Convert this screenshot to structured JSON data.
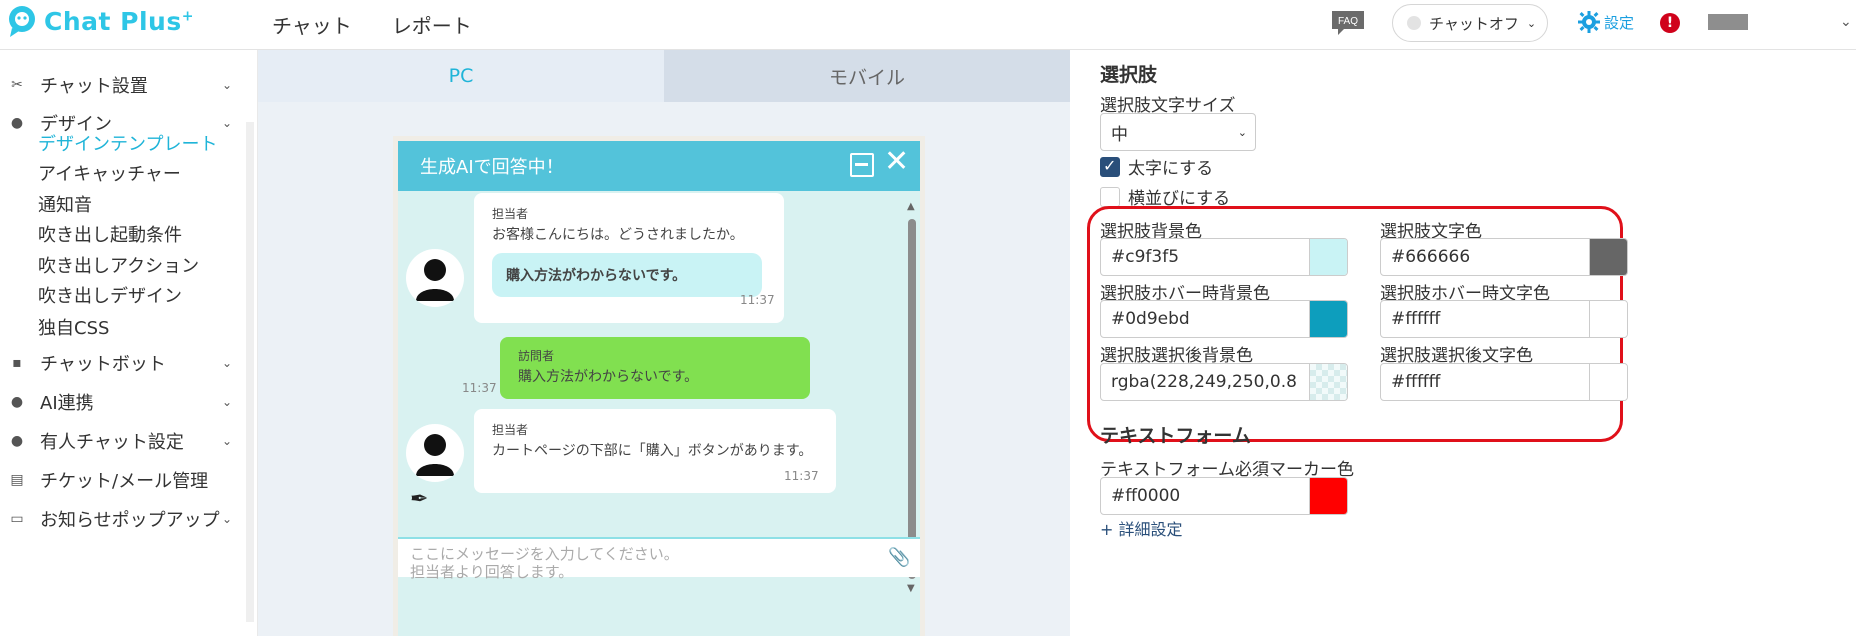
{
  "app": {
    "logo_text": "Chat Plus",
    "logo_sup": "+",
    "nav": [
      "チャット",
      "レポート"
    ],
    "faq_label": "FAQ",
    "chat_status": "チャットオフ",
    "settings_label": "設定",
    "alert_icon": "!",
    "brand_color": "#2ec6e6"
  },
  "sidebar": {
    "items": [
      {
        "icon": "✂",
        "label": "チャット設置"
      },
      {
        "icon": "●",
        "label": "デザイン"
      },
      {
        "icon": "▪",
        "label": "チャットボット"
      },
      {
        "icon": "●",
        "label": "AI連携"
      },
      {
        "icon": "●",
        "label": "有人チャット設定"
      },
      {
        "icon": "▤",
        "label": "チケット/メール管理"
      },
      {
        "icon": "▭",
        "label": "お知らせポップアップ"
      }
    ],
    "sub_items": [
      "デザインテンプレート",
      "アイキャッチャー",
      "通知音",
      "吹き出し起動条件",
      "吹き出しアクション",
      "吹き出しデザイン",
      "独自CSS"
    ],
    "active_sub": "デザインテンプレート"
  },
  "preview": {
    "tabs": [
      "PC",
      "モバイル"
    ],
    "widget": {
      "header": "生成AIで回答中！",
      "messages": [
        {
          "role": "担当者",
          "text": "お客様こんにちは。どうされましたか。",
          "choice": "購入方法がわからないです。",
          "time": "11:37"
        },
        {
          "role": "訪問者",
          "text": "購入方法がわからないです。",
          "time": "11:37"
        },
        {
          "role": "担当者",
          "text": "カートページの下部に「購入」ボタンがあります。",
          "time": "11:37"
        }
      ],
      "input_placeholder_1": "ここにメッセージを入力してください。",
      "input_placeholder_2": "担当者より回答します。"
    }
  },
  "settings": {
    "section_title": "選択肢",
    "font_size_label": "選択肢文字サイズ",
    "font_size_value": "中",
    "bold_label": "太字にする",
    "bold_checked": true,
    "horizontal_label": "横並びにする",
    "horizontal_checked": false,
    "colors": [
      {
        "label": "選択肢背景色",
        "value": "#c9f3f5",
        "swatch": "#c9f3f5"
      },
      {
        "label": "選択肢文字色",
        "value": "#666666",
        "swatch": "#666666"
      },
      {
        "label": "選択肢ホバー時背景色",
        "value": "#0d9ebd",
        "swatch": "#0d9ebd"
      },
      {
        "label": "選択肢ホバー時文字色",
        "value": "#ffffff",
        "swatch": "#ffffff"
      },
      {
        "label": "選択肢選択後背景色",
        "value": "rgba(228,249,250,0.8",
        "swatch": "checker"
      },
      {
        "label": "選択肢選択後文字色",
        "value": "#ffffff",
        "swatch": "#ffffff"
      }
    ],
    "text_form_title": "テキストフォーム",
    "required_marker_label": "テキストフォーム必須マーカー色",
    "required_marker_value": "#ff0000",
    "required_marker_swatch": "#ff0000",
    "detail_link": "+ 詳細設定"
  }
}
